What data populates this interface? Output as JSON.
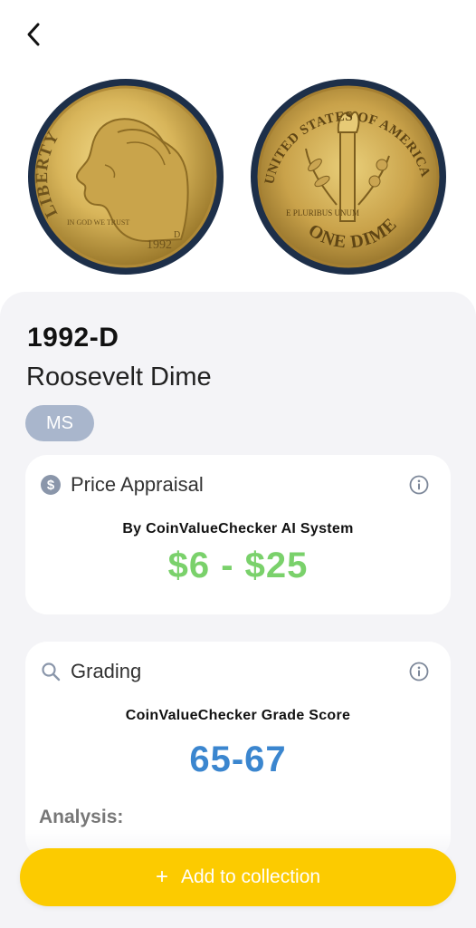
{
  "coin": {
    "year": "1992-D",
    "name": "Roosevelt Dime",
    "grade_badge": "MS",
    "obverse_legend": "LIBERTY",
    "obverse_motto": "IN GOD WE TRUST",
    "obverse_date": "1992",
    "obverse_mint": "D",
    "reverse_legend": "UNITED STATES OF AMERICA",
    "reverse_motto": "E PLURIBUS UNUM",
    "reverse_denomination": "ONE DIME"
  },
  "price_card": {
    "title": "Price Appraisal",
    "subtitle": "By CoinValueChecker AI System",
    "value": "$6 - $25",
    "icon": "dollar-circle-icon"
  },
  "grading_card": {
    "title": "Grading",
    "subtitle": "CoinValueChecker Grade Score",
    "value": "65-67",
    "analysis_label": "Analysis:",
    "icon": "search-icon"
  },
  "actions": {
    "add_plus": "+",
    "add_label": "Add to collection"
  },
  "colors": {
    "accent_yellow": "#fccb00",
    "price_green": "#7ad16b",
    "grade_blue": "#3b86cf",
    "badge_bg": "#a9b6cc"
  }
}
